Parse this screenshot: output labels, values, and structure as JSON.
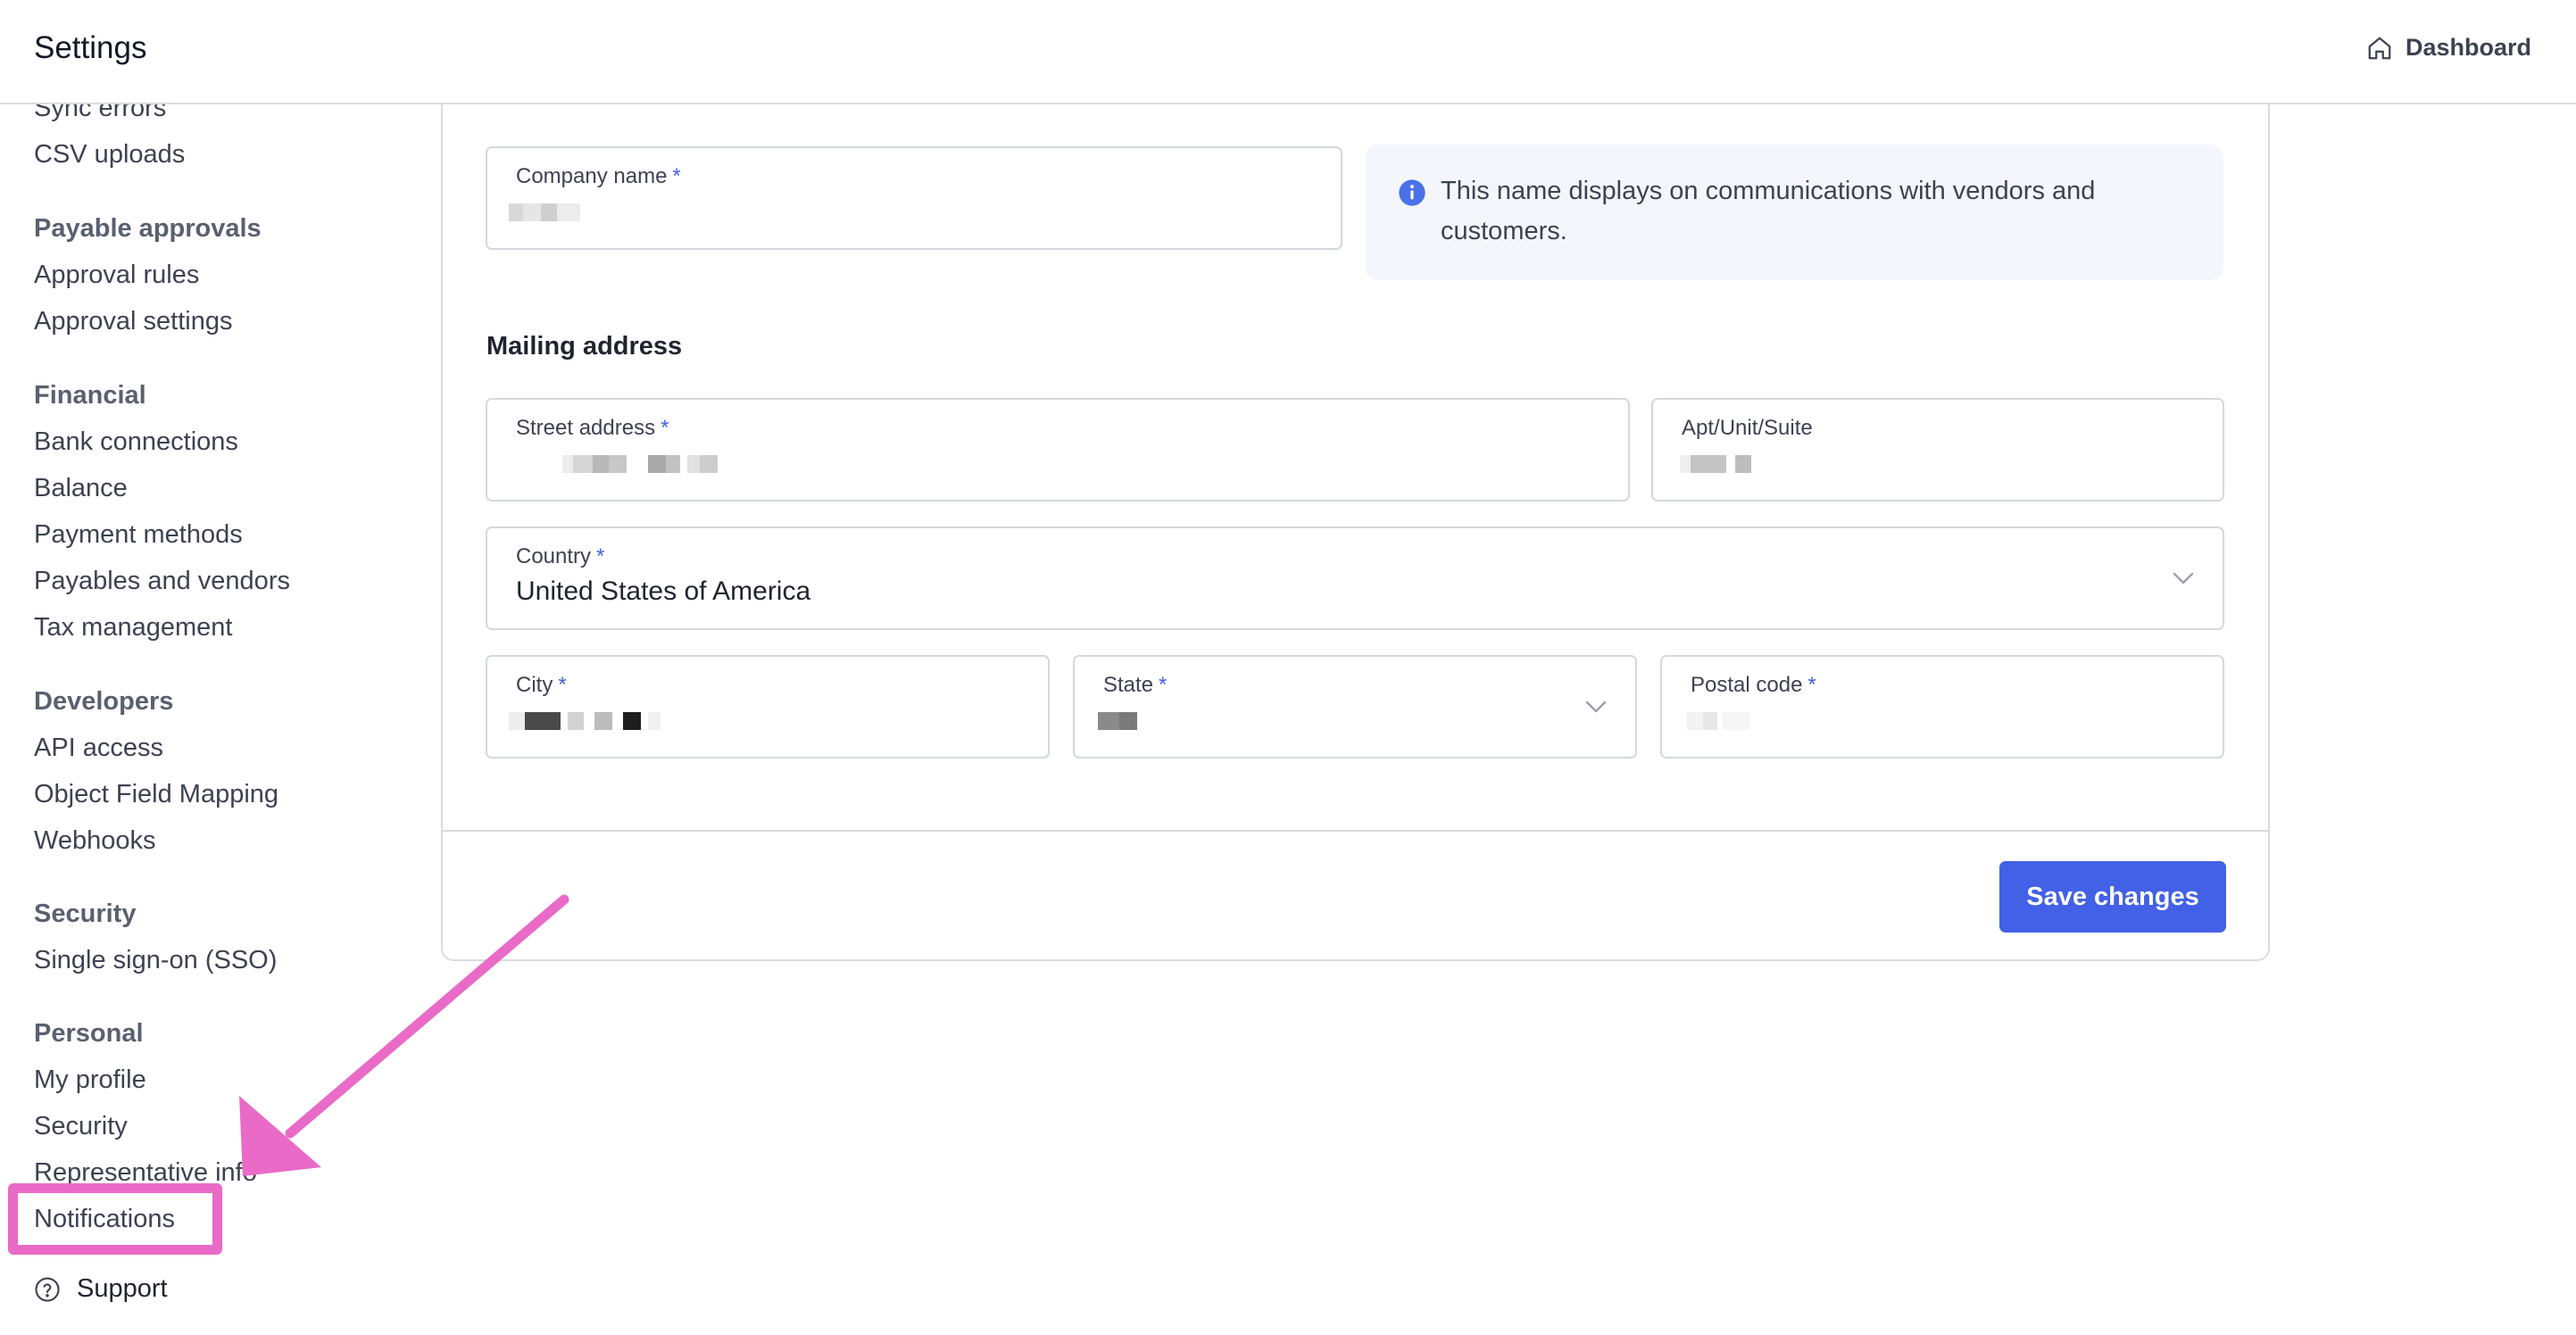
{
  "header": {
    "title": "Settings",
    "dashboard_label": "Dashboard"
  },
  "sidebar": {
    "items": [
      {
        "label": "Sync errors",
        "type": "item"
      },
      {
        "label": "CSV uploads",
        "type": "item"
      },
      {
        "label": "Payable approvals",
        "type": "heading"
      },
      {
        "label": "Approval rules",
        "type": "item"
      },
      {
        "label": "Approval settings",
        "type": "item"
      },
      {
        "label": "Financial",
        "type": "heading"
      },
      {
        "label": "Bank connections",
        "type": "item"
      },
      {
        "label": "Balance",
        "type": "item"
      },
      {
        "label": "Payment methods",
        "type": "item"
      },
      {
        "label": "Payables and vendors",
        "type": "item"
      },
      {
        "label": "Tax management",
        "type": "item"
      },
      {
        "label": "Developers",
        "type": "heading"
      },
      {
        "label": "API access",
        "type": "item"
      },
      {
        "label": "Object Field Mapping",
        "type": "item"
      },
      {
        "label": "Webhooks",
        "type": "item"
      },
      {
        "label": "Security",
        "type": "heading"
      },
      {
        "label": "Single sign-on (SSO)",
        "type": "item"
      },
      {
        "label": "Personal",
        "type": "heading"
      },
      {
        "label": "My profile",
        "type": "item"
      },
      {
        "label": "Security",
        "type": "item"
      },
      {
        "label": "Representative info",
        "type": "item"
      },
      {
        "label": "Notifications",
        "type": "item"
      }
    ],
    "support_label": "Support"
  },
  "form": {
    "company_name": {
      "label": "Company name",
      "required_mark": "*",
      "value": ""
    },
    "info_text": "This name displays on communications with vendors and customers.",
    "mailing_title": "Mailing address",
    "street": {
      "label": "Street address",
      "required_mark": "*",
      "value": ""
    },
    "apt": {
      "label": "Apt/Unit/Suite",
      "value": ""
    },
    "country": {
      "label": "Country",
      "required_mark": "*",
      "value": "United States of America"
    },
    "city": {
      "label": "City",
      "required_mark": "*",
      "value": ""
    },
    "state": {
      "label": "State",
      "required_mark": "*",
      "value": ""
    },
    "postal": {
      "label": "Postal code",
      "required_mark": "*",
      "value": ""
    },
    "save_label": "Save changes"
  },
  "colors": {
    "accent": "#4361e6",
    "annotation": "#ea6ac7",
    "info_bg": "#f4f6fb",
    "border": "#d5d8df"
  },
  "icons": {
    "dashboard": "home-icon",
    "support": "question-circle-icon",
    "info": "info-circle-icon",
    "dropdown": "chevron-down-icon"
  }
}
